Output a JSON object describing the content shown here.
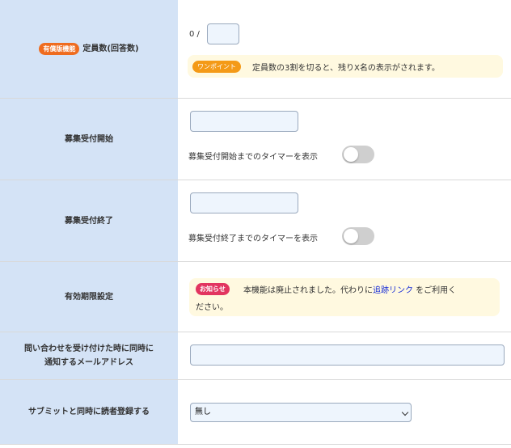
{
  "rows": {
    "capacity": {
      "badge": "有償版機能",
      "label": "定員数(回答数)",
      "prefix": "0 /",
      "value": "",
      "tip_badge": "ワンポイント",
      "tip_text": "定員数の3割を切ると、残りX名の表示がされます。"
    },
    "start": {
      "label": "募集受付開始",
      "value": "",
      "toggle_label": "募集受付開始までのタイマーを表示",
      "toggle_on": false
    },
    "end": {
      "label": "募集受付終了",
      "value": "",
      "toggle_label": "募集受付終了までのタイマーを表示",
      "toggle_on": false
    },
    "expiry": {
      "label": "有効期限設定",
      "notice_badge": "お知らせ",
      "notice_text_1": "本機能は廃止されました。代わりに",
      "notice_link": "追跡リンク",
      "notice_text_2": " をご利用く",
      "notice_text_3": "ださい。"
    },
    "notify": {
      "label_line1": "問い合わせを受け付けた時に同時に",
      "label_line2": "通知するメールアドレス",
      "value": ""
    },
    "submit": {
      "label": "サブミットと同時に読者登録する",
      "selected": "無し"
    }
  },
  "colors": {
    "label_bg": "#d4e3f6",
    "badge_orange": "#ef6c1f",
    "tip_badge": "#f49a17",
    "notice_badge": "#e23560",
    "notice_bg": "#fff9e0",
    "link": "#1a2fd6"
  }
}
